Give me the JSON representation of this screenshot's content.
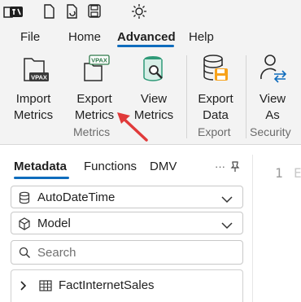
{
  "menu": {
    "tabs": [
      "File",
      "Home",
      "Advanced",
      "Help"
    ],
    "active": "Advanced"
  },
  "ribbon": {
    "import_metrics": [
      "Import",
      "Metrics"
    ],
    "export_metrics": [
      "Export",
      "Metrics"
    ],
    "view_metrics": [
      "View",
      "Metrics"
    ],
    "export_data": [
      "Export",
      "Data"
    ],
    "view_as": [
      "View",
      "As"
    ],
    "groups": [
      "Metrics",
      "Export",
      "Security"
    ],
    "vpax_badge": "VPAX"
  },
  "left_pane": {
    "tabs": [
      "Metadata",
      "Functions",
      "DMV"
    ],
    "active_tab": "Metadata",
    "database_dropdown": "AutoDateTime",
    "model_dropdown": "Model",
    "search_placeholder": "Search",
    "tree_item": "FactInternetSales"
  },
  "editor": {
    "line_number": "1",
    "text": "E"
  },
  "colors": {
    "accent": "#0f6cbd",
    "annotation_arrow": "#e03a3a",
    "view_metrics_icon": "#2f9a78",
    "export_data_icon": "#f7a21b"
  }
}
